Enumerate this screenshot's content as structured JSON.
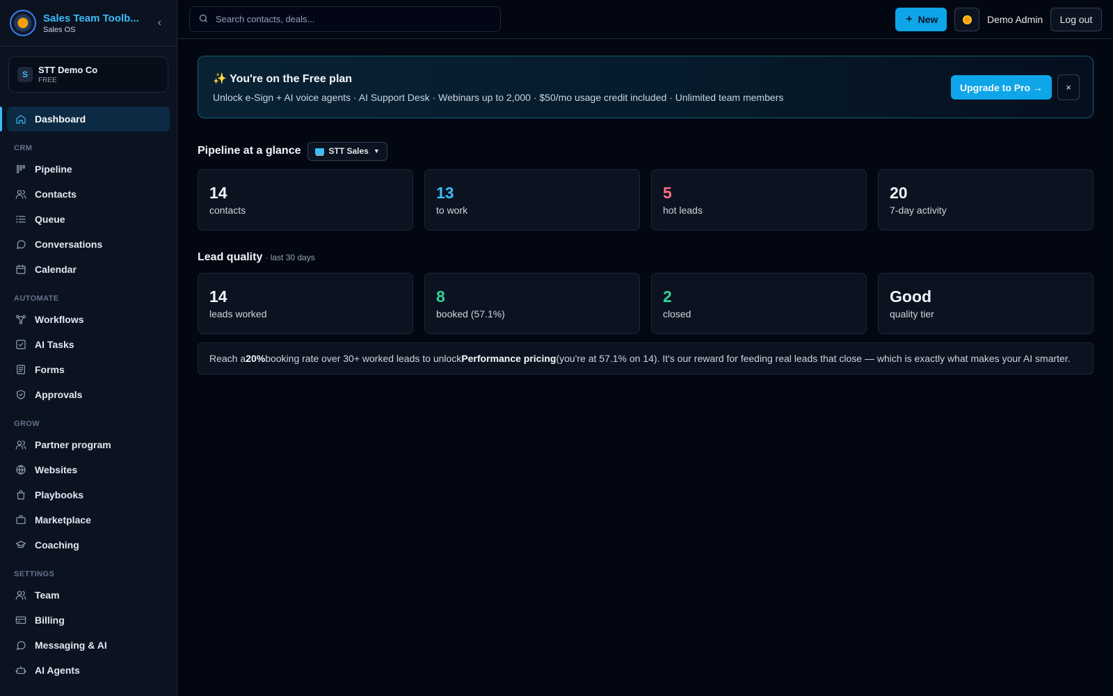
{
  "sidebar": {
    "brand_title": "Sales Team Toolb...",
    "brand_sub": "Sales OS",
    "collapse_glyph": "‹",
    "org_initial": "S",
    "org_name": "STT Demo Co",
    "org_plan": "FREE",
    "active_item": "Dashboard",
    "dashboard_label": "Dashboard",
    "sections": [
      {
        "title": "CRM",
        "items": [
          {
            "label": "Pipeline",
            "icon": "kanban-icon"
          },
          {
            "label": "Contacts",
            "icon": "users-icon"
          },
          {
            "label": "Queue",
            "icon": "list-icon"
          },
          {
            "label": "Conversations",
            "icon": "chat-icon"
          },
          {
            "label": "Calendar",
            "icon": "calendar-icon"
          }
        ]
      },
      {
        "title": "AUTOMATE",
        "items": [
          {
            "label": "Workflows",
            "icon": "workflow-icon"
          },
          {
            "label": "AI Tasks",
            "icon": "checkbox-icon"
          },
          {
            "label": "Forms",
            "icon": "form-icon"
          },
          {
            "label": "Approvals",
            "icon": "shield-check-icon"
          }
        ]
      },
      {
        "title": "GROW",
        "items": [
          {
            "label": "Partner program",
            "icon": "users-icon"
          },
          {
            "label": "Websites",
            "icon": "globe-icon"
          },
          {
            "label": "Playbooks",
            "icon": "bag-icon"
          },
          {
            "label": "Marketplace",
            "icon": "briefcase-icon"
          },
          {
            "label": "Coaching",
            "icon": "graduation-cap-icon"
          }
        ]
      },
      {
        "title": "SETTINGS",
        "items": [
          {
            "label": "Team",
            "icon": "users-icon"
          },
          {
            "label": "Billing",
            "icon": "credit-card-icon"
          },
          {
            "label": "Messaging & AI",
            "icon": "chat-icon"
          },
          {
            "label": "AI Agents",
            "icon": "robot-icon"
          }
        ]
      }
    ]
  },
  "topbar": {
    "search_placeholder": "Search contacts, deals...",
    "new_label": "New",
    "user_name": "Demo Admin",
    "logout_label": "Log out"
  },
  "banner": {
    "icon": "✨",
    "title": "You're on the Free plan",
    "text": "Unlock e-Sign + AI voice agents · AI Support Desk · Webinars up to 2,000 · $50/mo usage credit included · Unlimited team members",
    "upgrade_label": "Upgrade to Pro →",
    "dismiss_label": "×"
  },
  "pipeline": {
    "title": "Pipeline at a glance",
    "selected": "STT Sales",
    "stats": [
      {
        "value": "14",
        "label": "contacts",
        "color": "#f1f5f9"
      },
      {
        "value": "13",
        "label": "to work",
        "color": "#38bdf8"
      },
      {
        "value": "5",
        "label": "hot leads",
        "color": "#fb7185"
      },
      {
        "value": "20",
        "label": "7-day activity",
        "color": "#f1f5f9"
      }
    ]
  },
  "lead_quality": {
    "title": "Lead quality",
    "note": "· last 30 days",
    "stats": [
      {
        "value": "14",
        "label": "leads worked",
        "color": "#f1f5f9"
      },
      {
        "value": "8",
        "label": "booked (57.1%)",
        "color": "#34d399"
      },
      {
        "value": "2",
        "label": "closed",
        "color": "#34d399"
      },
      {
        "value": "Good",
        "label": "quality tier",
        "color": "#f1f5f9"
      }
    ],
    "notice": {
      "p1": "Reach a ",
      "b1": "20%",
      "p2": " booking rate over 30+ worked leads to unlock ",
      "b2": "Performance pricing",
      "p3": " (you're at 57.1% on 14). It's our reward for feeding real leads that close — which is exactly what makes your AI smarter."
    }
  }
}
